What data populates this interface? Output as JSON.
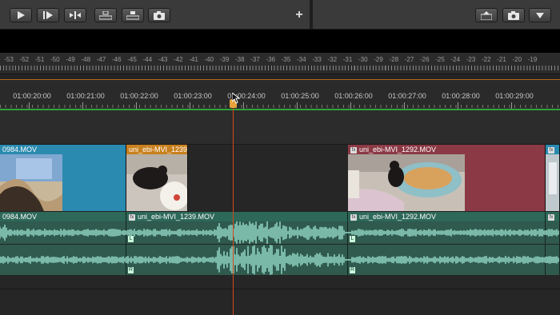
{
  "toolbar": {
    "buttons": [
      "play-icon",
      "step-forward-icon",
      "insert-edit-icon",
      "lift-icon",
      "extract-icon",
      "camera-icon",
      "export-frame-icon",
      "camera-icon",
      "button-editor-icon"
    ],
    "add_label": "+"
  },
  "meter": {
    "labels": [
      "-53",
      "-52",
      "-51",
      "-50",
      "-49",
      "-48",
      "-47",
      "-46",
      "-45",
      "-44",
      "-43",
      "-42",
      "-41",
      "-40",
      "-39",
      "-38",
      "-37",
      "-36",
      "-35",
      "-34",
      "-33",
      "-32",
      "-31",
      "-30",
      "-29",
      "-28",
      "-27",
      "-26",
      "-25",
      "-24",
      "-23",
      "-22",
      "-21",
      "-20",
      "-19"
    ]
  },
  "ruler": {
    "timecodes": [
      "01:00:20:00",
      "01:00:21:00",
      "01:00:22:00",
      "01:00:23:00",
      "01:00:24:00",
      "01:00:25:00",
      "01:00:26:00",
      "01:00:27:00",
      "01:00:28:00",
      "01:00:29:00"
    ]
  },
  "video_clips": [
    {
      "name": "0984.MOV",
      "fx": false
    },
    {
      "name": "uni_ebi-MVI_1239.MOV",
      "fx": false
    },
    {
      "name": "uni_ebi-MVI_1292.MOV",
      "fx": true
    },
    {
      "name": "",
      "fx": true
    }
  ],
  "audio_clips": [
    {
      "name": "0984.MOV",
      "fx": false
    },
    {
      "name": "uni_ebi-MVI_1239.MOV",
      "fx": true
    },
    {
      "name": "uni_ebi-MVI_1292.MOV",
      "fx": true
    },
    {
      "name": "",
      "fx": true
    }
  ],
  "audio_channels": {
    "left": "L",
    "right": "R"
  },
  "colors": {
    "playhead": "#d5491d",
    "video_clip_blue": "#2a8ab0",
    "video_clip_orange": "#c8801e",
    "video_clip_red": "#8b3a45",
    "audio_clip": "#2f5a4d",
    "waveform": "#8ed1bf",
    "timeline_green": "#2ea43a"
  }
}
